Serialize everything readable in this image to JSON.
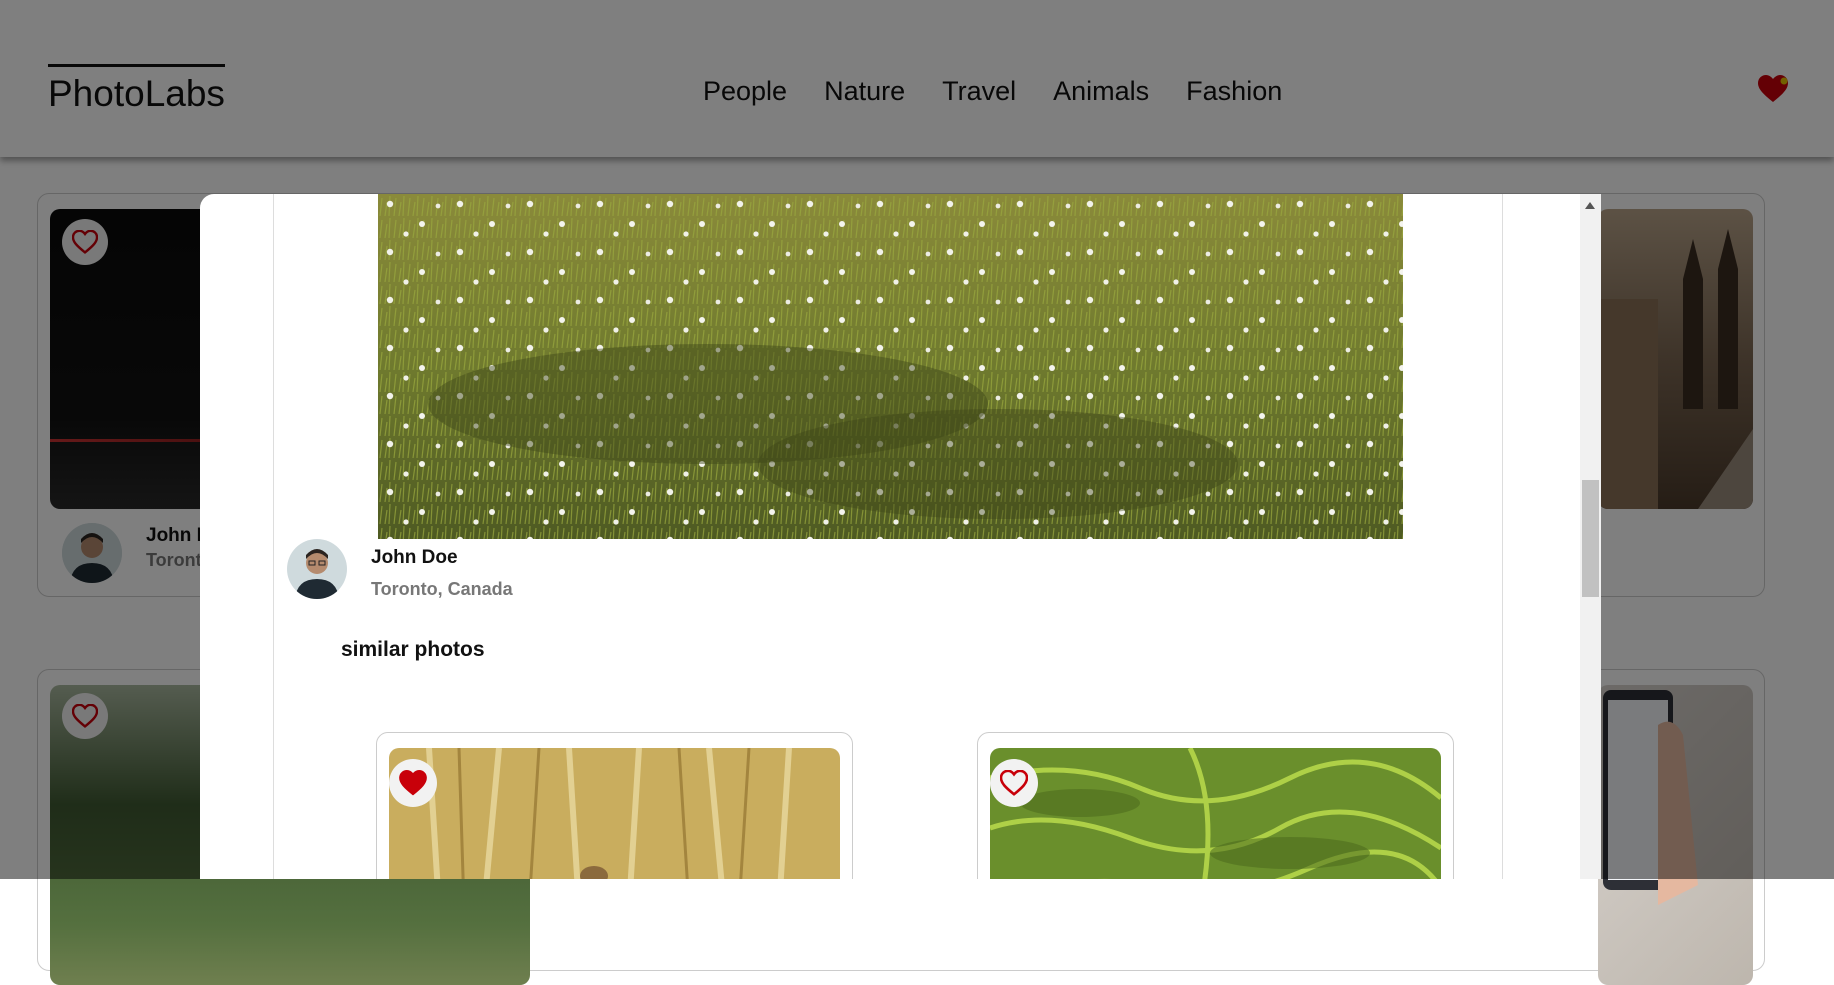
{
  "app": {
    "logo": "PhotoLabs"
  },
  "nav": {
    "topics": [
      "People",
      "Nature",
      "Travel",
      "Animals",
      "Fashion"
    ]
  },
  "background_cards": [
    {
      "name": "John D",
      "location": "Toront"
    },
    {
      "name": "",
      "location": ""
    }
  ],
  "modal": {
    "photo": {
      "user_name": "John Doe",
      "location": "Toronto, Canada"
    },
    "similar_title": "similar photos",
    "similar_photos": [
      {
        "favourited": true
      },
      {
        "favourited": false
      }
    ]
  },
  "colors": {
    "accent": "#c8000a",
    "overlay": "rgba(0,0,0,0.5)"
  },
  "icons": [
    "heart-icon",
    "favourite-badge-icon"
  ]
}
